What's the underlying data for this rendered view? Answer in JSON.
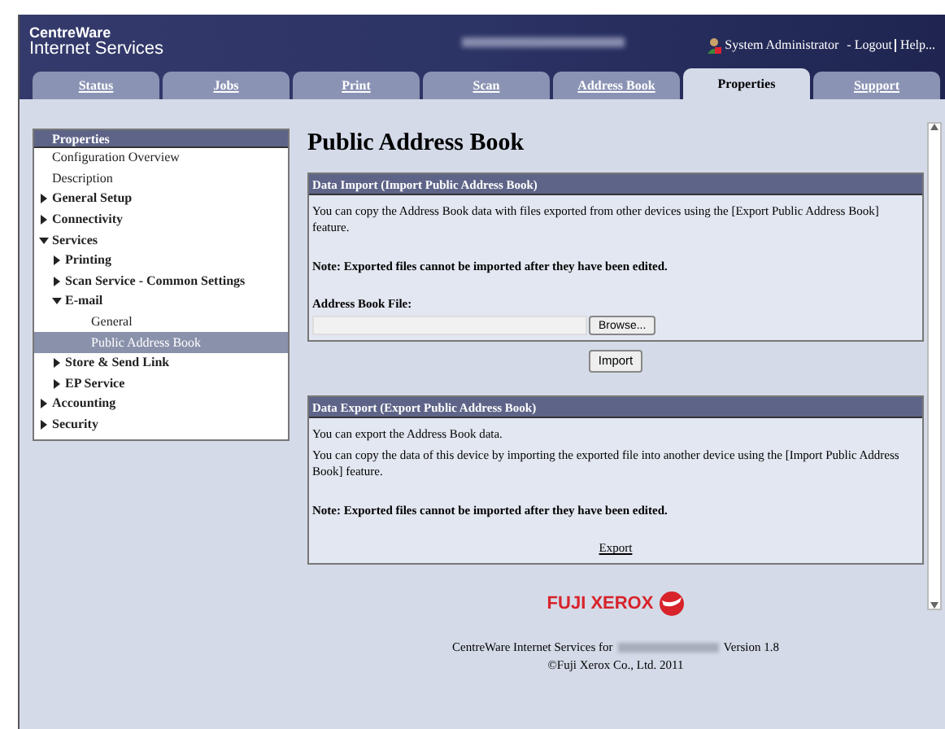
{
  "header": {
    "logo_line1": "CentreWare",
    "logo_line2": "Internet Services",
    "user": "System Administrator",
    "logout": "- Logout",
    "help": "Help..."
  },
  "tabs": [
    {
      "label": "Status",
      "selected": false
    },
    {
      "label": "Jobs",
      "selected": false
    },
    {
      "label": "Print",
      "selected": false
    },
    {
      "label": "Scan",
      "selected": false
    },
    {
      "label": "Address Book",
      "selected": false
    },
    {
      "label": "Properties",
      "selected": true
    },
    {
      "label": "Support",
      "selected": false
    }
  ],
  "sidebar": {
    "title": "Properties",
    "items": [
      {
        "label": "Configuration Overview",
        "selected": false
      },
      {
        "label": "Description",
        "selected": false
      },
      {
        "label": "General Setup",
        "expanded": false,
        "selected": false
      },
      {
        "label": "Connectivity",
        "expanded": false,
        "selected": false
      },
      {
        "label": "Services",
        "expanded": true,
        "selected": false,
        "children": [
          {
            "label": "Printing",
            "expanded": false,
            "selected": false
          },
          {
            "label": "Scan Service - Common Settings",
            "expanded": false,
            "selected": false
          },
          {
            "label": "E-mail",
            "expanded": true,
            "selected": false,
            "children": [
              {
                "label": "General",
                "selected": false
              },
              {
                "label": "Public Address Book",
                "selected": true
              }
            ]
          },
          {
            "label": "Store & Send Link",
            "expanded": false,
            "selected": false
          },
          {
            "label": "EP Service",
            "expanded": false,
            "selected": false
          }
        ]
      },
      {
        "label": "Accounting",
        "expanded": false,
        "selected": false
      },
      {
        "label": "Security",
        "expanded": false,
        "selected": false
      }
    ]
  },
  "page_title": "Public Address Book",
  "import_panel": {
    "title": "Data Import (Import Public Address Book)",
    "text": "You can copy the Address Book data with files exported from other devices using the [Export Public Address Book] feature.",
    "note": "Note: Exported files cannot be imported after they have been edited.",
    "file_label": "Address Book File:",
    "browse_button": "Browse..."
  },
  "import_button": "Import",
  "export_panel": {
    "title": "Data Export (Export Public Address Book)",
    "texts": [
      "You can export the Address Book data.",
      "You can copy the data of this device by importing the exported file into another device using the [Import Public Address Book] feature."
    ],
    "note": "Note: Exported files cannot be imported after they have been edited.",
    "export_link": "Export"
  },
  "footer": {
    "brand": "FUJI XEROX",
    "product_prefix": "CentreWare Internet Services for",
    "version": "Version 1.8",
    "copyright": "©Fuji Xerox Co., Ltd. 2011"
  }
}
